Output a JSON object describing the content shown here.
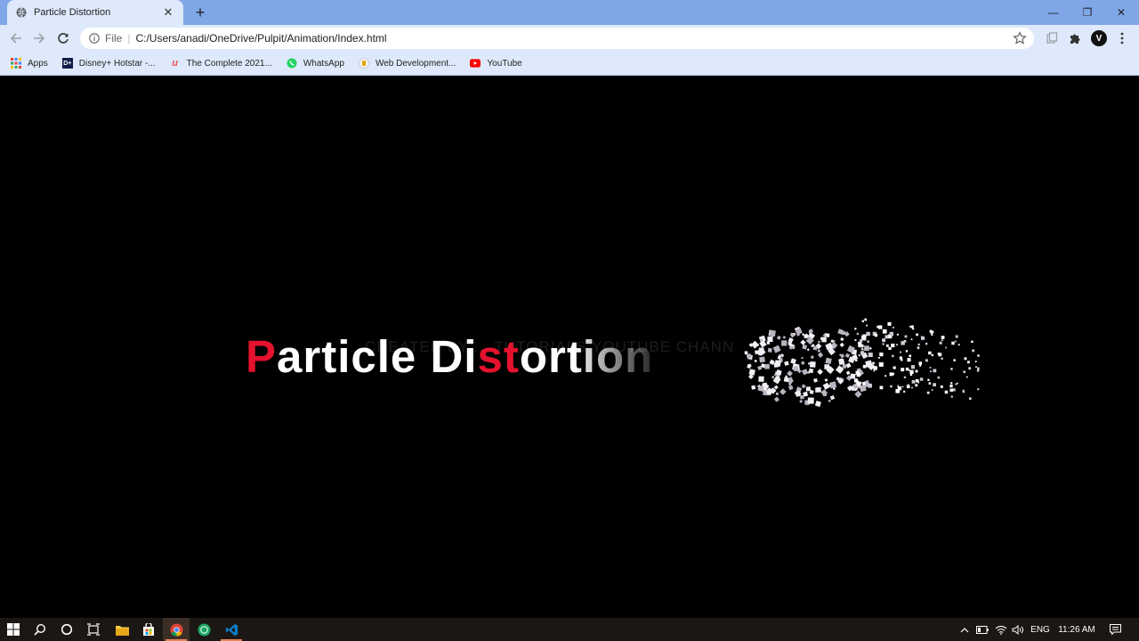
{
  "window": {
    "tab_title": "Particle Distortion",
    "tab_close": "✕",
    "new_tab": "+",
    "minimize": "—",
    "maximize": "❐",
    "close": "✕"
  },
  "toolbar": {
    "url_scheme": "File",
    "url_separator": "|",
    "url": "C:/Users/anadi/OneDrive/Pulpit/Animation/Index.html",
    "profile_initial": "V"
  },
  "bookmarks": [
    {
      "label": "Apps",
      "icon": "apps-grid-icon"
    },
    {
      "label": "Disney+ Hotstar -...",
      "icon": "hotstar-icon"
    },
    {
      "label": "The Complete 2021...",
      "icon": "udemy-icon"
    },
    {
      "label": "WhatsApp",
      "icon": "whatsapp-icon"
    },
    {
      "label": "Web Development...",
      "icon": "web-dev-icon"
    },
    {
      "label": "YouTube",
      "icon": "youtube-icon"
    }
  ],
  "page": {
    "heading_parts": [
      {
        "text": "P",
        "color": "#e5122d"
      },
      {
        "text": "article Di",
        "color": "#ffffff"
      },
      {
        "text": "st",
        "color": "#e5122d"
      },
      {
        "text": "ortion",
        "color": "#ffffff"
      }
    ],
    "credit_text": "CREATED BY ... TUTORIALS YOUTUBE CHANN",
    "accent_color": "#e5122d"
  },
  "taskbar": {
    "language": "ENG",
    "time": "11:26 AM",
    "accent": "#e8855c"
  }
}
